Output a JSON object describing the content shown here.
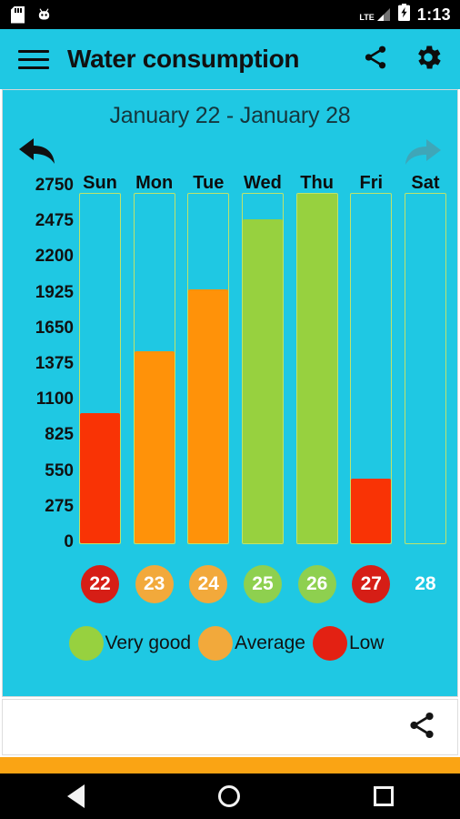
{
  "status_bar": {
    "time": "1:13",
    "network_label": "LTE",
    "icons": [
      "sd-card-icon",
      "android-head-icon",
      "lte-signal-icon",
      "battery-charging-icon"
    ]
  },
  "app_bar": {
    "title": "Water consumption",
    "menu_icon": "hamburger-menu-icon",
    "share_icon": "share-icon",
    "settings_icon": "gear-icon"
  },
  "card": {
    "date_range": "January 22 - January 28",
    "prev_label": "Previous week",
    "next_label": "Next week"
  },
  "colors": {
    "accent_cyan": "#1FC8E3",
    "very_good": "#97D13F",
    "average": "#FF9209",
    "low": "#F93305",
    "date_low": "#D61E16",
    "date_average": "#F2A93B",
    "date_very_good": "#8ED04F",
    "track_outline": "#bfe36a",
    "orange_strip": "#FAA414"
  },
  "chart_data": {
    "type": "bar",
    "title": "January 22 - January 28",
    "xlabel": "",
    "ylabel": "",
    "ylim": [
      0,
      2750
    ],
    "yticks": [
      2750,
      2475,
      2200,
      1925,
      1650,
      1375,
      1100,
      825,
      550,
      275,
      0
    ],
    "grid": false,
    "legend_position": "bottom",
    "categories": [
      "Sun",
      "Mon",
      "Tue",
      "Wed",
      "Thu",
      "Fri",
      "Sat"
    ],
    "values": [
      1025,
      1510,
      2000,
      2550,
      2750,
      510,
      0
    ],
    "bar_levels": [
      "Low",
      "Average",
      "Average",
      "Very good",
      "Very good",
      "Low",
      "None"
    ],
    "dates": [
      {
        "day": "22",
        "level": "Low"
      },
      {
        "day": "23",
        "level": "Average"
      },
      {
        "day": "24",
        "level": "Average"
      },
      {
        "day": "25",
        "level": "Very good"
      },
      {
        "day": "26",
        "level": "Very good"
      },
      {
        "day": "27",
        "level": "Low"
      },
      {
        "day": "28",
        "level": "None"
      }
    ],
    "legend": [
      {
        "label": "Very good",
        "color": "#97D13F"
      },
      {
        "label": "Average",
        "color": "#F2A93B"
      },
      {
        "label": "Low",
        "color": "#E32113"
      }
    ]
  },
  "bottom_bar": {
    "share_icon": "share-icon"
  },
  "system_nav": {
    "back": "back-button",
    "home": "home-button",
    "recents": "recents-button"
  }
}
